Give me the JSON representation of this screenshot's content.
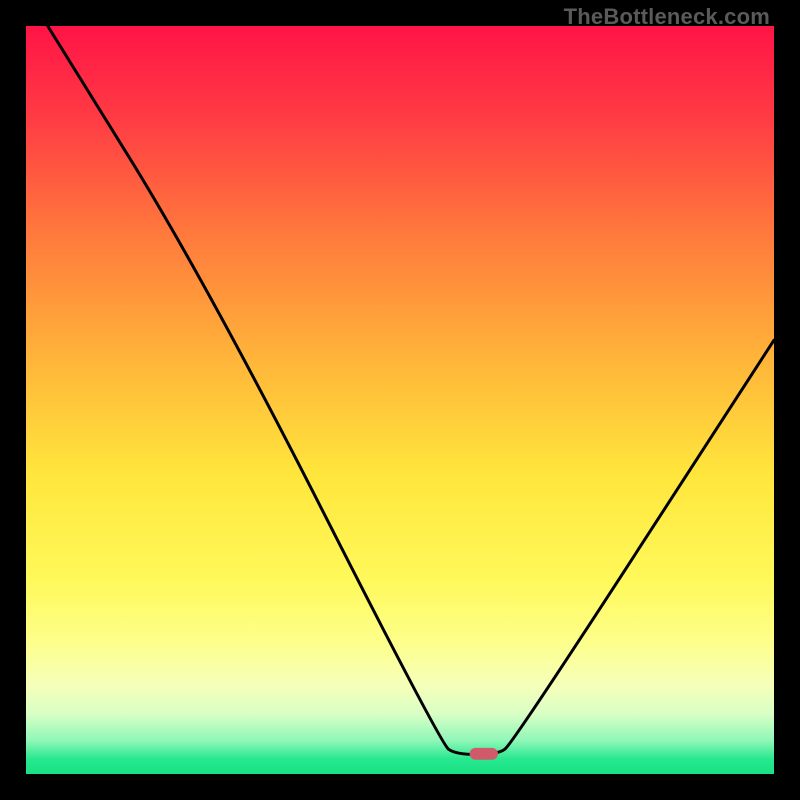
{
  "watermark": "TheBottleneck.com",
  "chart_data": {
    "type": "line",
    "title": "",
    "xlabel": "",
    "ylabel": "",
    "x_range": [
      0,
      100
    ],
    "y_range": [
      0,
      100
    ],
    "curve": [
      {
        "x": 2.9,
        "y": 100
      },
      {
        "x": 24.0,
        "y": 66
      },
      {
        "x": 55.5,
        "y": 4
      },
      {
        "x": 57.5,
        "y": 2.6
      },
      {
        "x": 63.0,
        "y": 2.6
      },
      {
        "x": 65.0,
        "y": 4
      },
      {
        "x": 100,
        "y": 58
      }
    ],
    "marker": {
      "x_center": 61.2,
      "y": 2.7,
      "width": 3.8,
      "height": 1.6,
      "color": "#d05a6a"
    },
    "gradient_stops": [
      {
        "offset": 0.0,
        "color": "#ff1446"
      },
      {
        "offset": 0.12,
        "color": "#ff3a44"
      },
      {
        "offset": 0.28,
        "color": "#ff7a3c"
      },
      {
        "offset": 0.45,
        "color": "#ffb63a"
      },
      {
        "offset": 0.6,
        "color": "#ffe63c"
      },
      {
        "offset": 0.74,
        "color": "#fff95a"
      },
      {
        "offset": 0.82,
        "color": "#fdff88"
      },
      {
        "offset": 0.88,
        "color": "#f6ffb8"
      },
      {
        "offset": 0.92,
        "color": "#d8ffc6"
      },
      {
        "offset": 0.955,
        "color": "#90f7b8"
      },
      {
        "offset": 0.98,
        "color": "#28e88f"
      },
      {
        "offset": 1.0,
        "color": "#18e085"
      }
    ]
  }
}
